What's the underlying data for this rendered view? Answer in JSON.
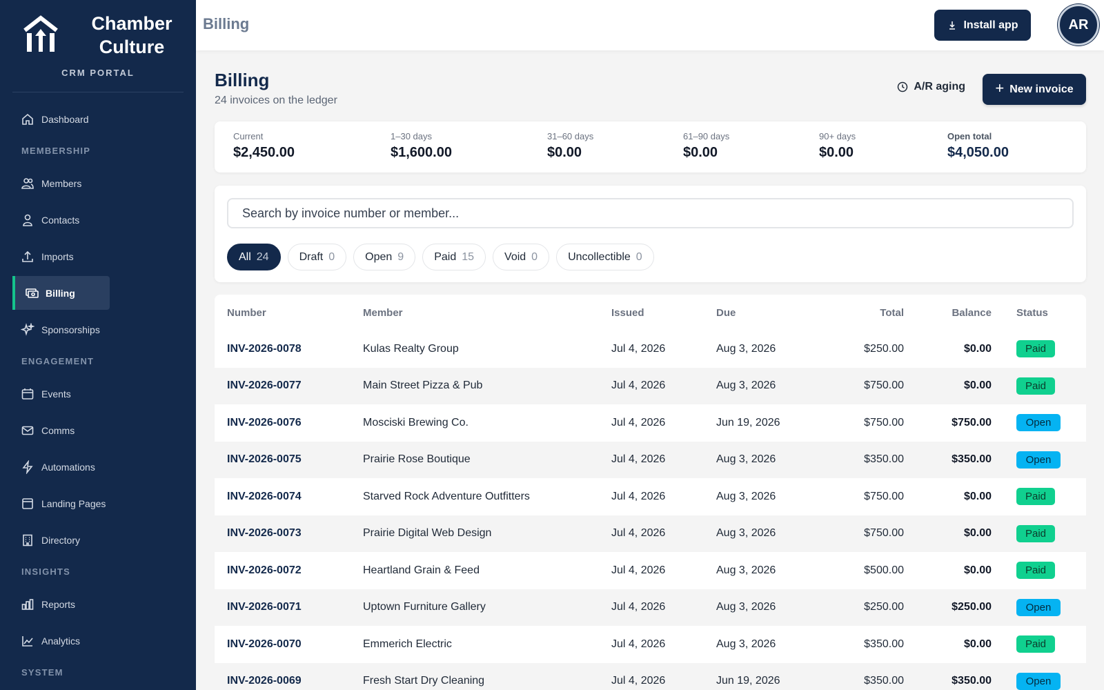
{
  "brand": {
    "name_line1": "Chamber",
    "name_line2": "Culture",
    "subtitle": "CRM PORTAL"
  },
  "nav": {
    "dashboard": "Dashboard",
    "section_membership": "MEMBERSHIP",
    "members": "Members",
    "contacts": "Contacts",
    "imports": "Imports",
    "billing": "Billing",
    "sponsorships": "Sponsorships",
    "section_engagement": "ENGAGEMENT",
    "events": "Events",
    "comms": "Comms",
    "automations": "Automations",
    "landing_pages": "Landing Pages",
    "directory": "Directory",
    "section_insights": "INSIGHTS",
    "reports": "Reports",
    "analytics": "Analytics",
    "section_system": "SYSTEM",
    "active": "Billing"
  },
  "header": {
    "title": "Billing",
    "install_label": "Install app",
    "avatar_initials": "AR"
  },
  "page": {
    "title": "Billing",
    "subtitle": "24 invoices on the ledger",
    "aging_label": "A/R aging",
    "new_invoice_label": "New invoice"
  },
  "aging": {
    "current_label": "Current",
    "current_value": "$2,450.00",
    "d30_label": "1–30 days",
    "d30_value": "$1,600.00",
    "d60_label": "31–60 days",
    "d60_value": "$0.00",
    "d90_label": "61–90 days",
    "d90_value": "$0.00",
    "d90p_label": "90+ days",
    "d90p_value": "$0.00",
    "open_label": "Open total",
    "open_value": "$4,050.00"
  },
  "search": {
    "placeholder": "Search by invoice number or member..."
  },
  "filters": [
    {
      "label": "All",
      "count": "24",
      "active": true
    },
    {
      "label": "Draft",
      "count": "0"
    },
    {
      "label": "Open",
      "count": "9"
    },
    {
      "label": "Paid",
      "count": "15"
    },
    {
      "label": "Void",
      "count": "0"
    },
    {
      "label": "Uncollectible",
      "count": "0"
    }
  ],
  "table": {
    "headers": {
      "number": "Number",
      "member": "Member",
      "issued": "Issued",
      "due": "Due",
      "total": "Total",
      "balance": "Balance",
      "status": "Status"
    },
    "rows": [
      {
        "number": "INV-2026-0078",
        "member": "Kulas Realty Group",
        "issued": "Jul 4, 2026",
        "due": "Aug 3, 2026",
        "total": "$250.00",
        "balance": "$0.00",
        "status": "Paid"
      },
      {
        "number": "INV-2026-0077",
        "member": "Main Street Pizza & Pub",
        "issued": "Jul 4, 2026",
        "due": "Aug 3, 2026",
        "total": "$750.00",
        "balance": "$0.00",
        "status": "Paid"
      },
      {
        "number": "INV-2026-0076",
        "member": "Mosciski Brewing Co.",
        "issued": "Jul 4, 2026",
        "due": "Jun 19, 2026",
        "total": "$750.00",
        "balance": "$750.00",
        "status": "Open"
      },
      {
        "number": "INV-2026-0075",
        "member": "Prairie Rose Boutique",
        "issued": "Jul 4, 2026",
        "due": "Aug 3, 2026",
        "total": "$350.00",
        "balance": "$350.00",
        "status": "Open"
      },
      {
        "number": "INV-2026-0074",
        "member": "Starved Rock Adventure Outfitters",
        "issued": "Jul 4, 2026",
        "due": "Aug 3, 2026",
        "total": "$750.00",
        "balance": "$0.00",
        "status": "Paid"
      },
      {
        "number": "INV-2026-0073",
        "member": "Prairie Digital Web Design",
        "issued": "Jul 4, 2026",
        "due": "Aug 3, 2026",
        "total": "$750.00",
        "balance": "$0.00",
        "status": "Paid"
      },
      {
        "number": "INV-2026-0072",
        "member": "Heartland Grain & Feed",
        "issued": "Jul 4, 2026",
        "due": "Aug 3, 2026",
        "total": "$500.00",
        "balance": "$0.00",
        "status": "Paid"
      },
      {
        "number": "INV-2026-0071",
        "member": "Uptown Furniture Gallery",
        "issued": "Jul 4, 2026",
        "due": "Aug 3, 2026",
        "total": "$250.00",
        "balance": "$250.00",
        "status": "Open"
      },
      {
        "number": "INV-2026-0070",
        "member": "Emmerich Electric",
        "issued": "Jul 4, 2026",
        "due": "Aug 3, 2026",
        "total": "$350.00",
        "balance": "$0.00",
        "status": "Paid"
      },
      {
        "number": "INV-2026-0069",
        "member": "Fresh Start Dry Cleaning",
        "issued": "Jul 4, 2026",
        "due": "Jun 19, 2026",
        "total": "$350.00",
        "balance": "$350.00",
        "status": "Open"
      }
    ]
  },
  "colors": {
    "navy": "#13294b",
    "accent_green": "#15c48c",
    "paid": "#10d08f",
    "open": "#05b3f2"
  }
}
